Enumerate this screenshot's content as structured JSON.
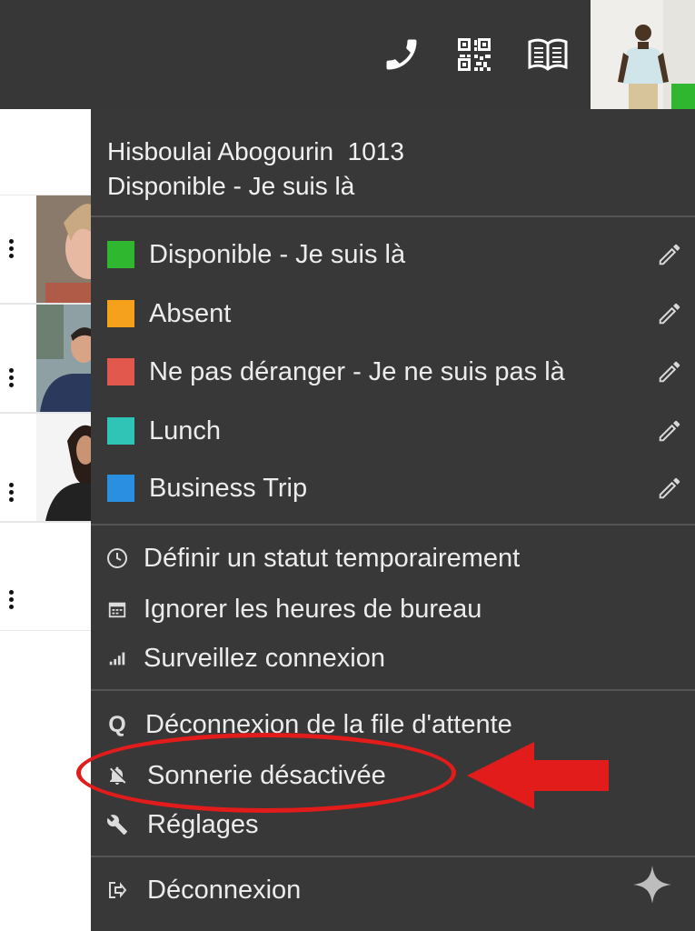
{
  "topbar": {
    "icons": [
      "phone-icon",
      "qr-code-icon",
      "book-icon"
    ]
  },
  "profile": {
    "name_ext": "Hisboulai Abogourin  1013",
    "current_status": "Disponible - Je suis là"
  },
  "statuses": [
    {
      "label": "Disponible - Je suis là",
      "color": "#2fb82f"
    },
    {
      "label": "Absent",
      "color": "#f5a11c"
    },
    {
      "label": "Ne pas déranger - Je ne suis pas là",
      "color": "#e3584c"
    },
    {
      "label": "Lunch",
      "color": "#2ec4b6"
    },
    {
      "label": "Business Trip",
      "color": "#2a8fe0"
    }
  ],
  "options": [
    {
      "label": "Définir un statut temporairement",
      "icon": "clock-icon"
    },
    {
      "label": "Ignorer les heures de bureau",
      "icon": "calendar-icon"
    },
    {
      "label": "Surveillez connexion",
      "icon": "signal-icon"
    }
  ],
  "queue_items": [
    {
      "label": "Déconnexion de la file d'attente",
      "icon": "queue-icon",
      "glyph": "Q"
    },
    {
      "label": "Sonnerie désactivée",
      "icon": "bell-off-icon"
    },
    {
      "label": "Réglages",
      "icon": "wrench-icon"
    }
  ],
  "logout": {
    "label": "Déconnexion",
    "icon": "logout-icon"
  },
  "colors": {
    "menu_bg": "#383838",
    "topbar_bg": "#373737",
    "annotation_red": "#e21b1b",
    "presence": "#2fb82f"
  }
}
